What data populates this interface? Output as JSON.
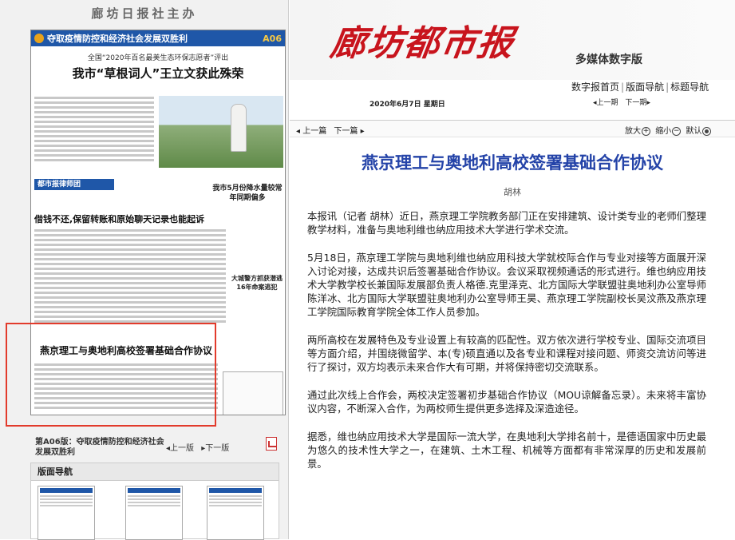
{
  "left": {
    "sponsor": "廊坊日报社主办",
    "paper": {
      "banner_title": "夺取疫情防控和经济社会发展双胜利",
      "page_no": "A06",
      "subhead": "全国“2020年百名最美生态环保志愿者”评出",
      "headline": "我市“草根词人”王立文获此殊荣",
      "rubric": "都市报律师团",
      "side_story_1": "我市5月份降水量较常年同期偏多",
      "story_2_title": "借钱不还,保留转账和原始聊天记录也能起诉",
      "side_story_2": "大城警方抓获潜逃16年命案逃犯",
      "story_3_title": "燕京理工与奥地利高校签署基础合作协议"
    },
    "page_info": "第A06版：夺取疫情防控和经济社会发展双胜利",
    "prev_page": "上一版",
    "next_page": "下一版",
    "nav_panel_title": "版面导航"
  },
  "right": {
    "masthead": "廊坊都市报",
    "edition": "多媒体数字版",
    "nav": [
      "数字报首页",
      "版面导航",
      "标题导航"
    ],
    "date": "2020年6月7日  星期日",
    "issue_prev": "上一期",
    "issue_next": "下一期",
    "article_prev": "上一篇",
    "article_next": "下一篇",
    "zoom_in": "放大",
    "zoom_out": "缩小",
    "zoom_default": "默认",
    "article": {
      "title": "燕京理工与奥地利高校签署基础合作协议",
      "author": "胡林",
      "paragraphs": [
        "本报讯（记者 胡林）近日，燕京理工学院教务部门正在安排建筑、设计类专业的老师们整理教学材料，准备与奥地利维也纳应用技术大学进行学术交流。",
        "5月18日，燕京理工学院与奥地利维也纳应用科技大学就校际合作与专业对接等方面展开深入讨论对接，达成共识后签署基础合作协议。会议采取视频通话的形式进行。维也纳应用技术大学教学校长兼国际发展部负责人格德.克里泽克、北方国际大学联盟驻奥地利办公室导师陈洋冰、北方国际大学联盟驻奥地利办公室导师王昊、燕京理工学院副校长吴汶燕及燕京理工学院国际教育学院全体工作人员参加。",
        "两所高校在发展特色及专业设置上有较高的匹配性。双方依次进行学校专业、国际交流项目等方面介绍，并围绕微留学、本(专)硕直通以及各专业和课程对接问题、师资交流访问等进行了探讨，双方均表示未来合作大有可期，并将保持密切交流联系。",
        "通过此次线上合作会，两校决定签署初步基础合作协议（MOU谅解备忘录）。未来将丰富协议内容，不断深入合作，为两校师生提供更多选择及深造途径。",
        "据悉，维也纳应用技术大学是国际一流大学，在奥地利大学排名前十，是德语国家中历史最为悠久的技术性大学之一，在建筑、土木工程、机械等方面都有非常深厚的历史和发展前景。"
      ]
    }
  }
}
